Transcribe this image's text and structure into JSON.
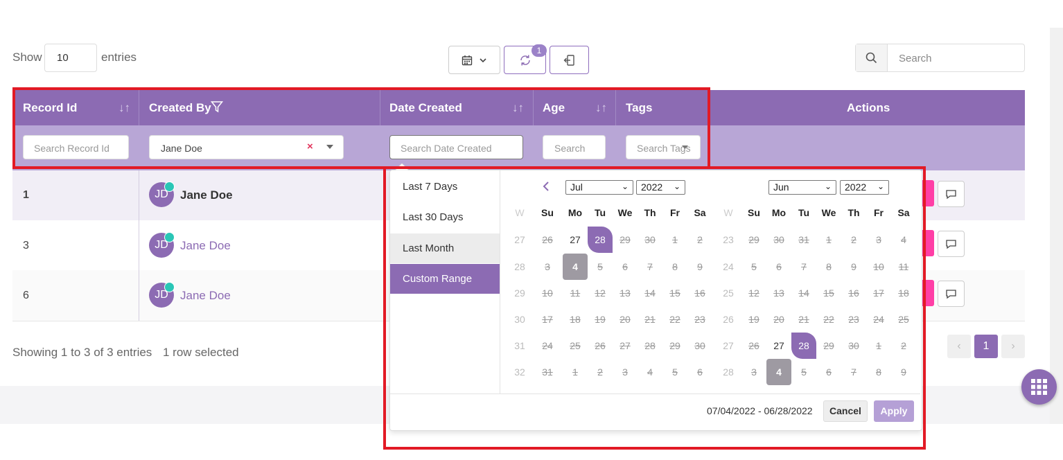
{
  "toolbar": {
    "show_label": "Show",
    "entries_value": "10",
    "entries_label": "entries",
    "sync_badge": "1",
    "search_placeholder": "Search"
  },
  "table": {
    "columns": [
      "Record Id",
      "Created By",
      "Date Created",
      "Age",
      "Tags",
      "Actions"
    ],
    "filters": {
      "record_id_placeholder": "Search Record Id",
      "created_by_value": "Jane Doe",
      "date_created_placeholder": "Search Date Created",
      "age_placeholder": "Search",
      "tags_placeholder": "Search Tags"
    },
    "rows": [
      {
        "id": "1",
        "initials": "JD",
        "name": "Jane Doe",
        "selected": true
      },
      {
        "id": "3",
        "initials": "JD",
        "name": "Jane Doe",
        "selected": false
      },
      {
        "id": "6",
        "initials": "JD",
        "name": "Jane Doe",
        "selected": false
      }
    ]
  },
  "footer": {
    "showing": "Showing 1 to 3 of 3 entries",
    "selected": "1 row selected",
    "page": "1"
  },
  "datepicker": {
    "ranges": [
      "Last 7 Days",
      "Last 30 Days",
      "Last Month",
      "Custom Range"
    ],
    "active_range": "Custom Range",
    "left": {
      "month": "Jul",
      "year": "2022"
    },
    "right": {
      "month": "Jun",
      "year": "2022"
    },
    "weekday_headers": [
      "W",
      "Su",
      "Mo",
      "Tu",
      "We",
      "Th",
      "Fr",
      "Sa"
    ],
    "left_weeks": [
      [
        "27",
        "26",
        "27",
        "28",
        "29",
        "30",
        "1",
        "2"
      ],
      [
        "28",
        "3",
        "4",
        "5",
        "6",
        "7",
        "8",
        "9"
      ],
      [
        "29",
        "10",
        "11",
        "12",
        "13",
        "14",
        "15",
        "16"
      ],
      [
        "30",
        "17",
        "18",
        "19",
        "20",
        "21",
        "22",
        "23"
      ],
      [
        "31",
        "24",
        "25",
        "26",
        "27",
        "28",
        "29",
        "30"
      ],
      [
        "32",
        "31",
        "1",
        "2",
        "3",
        "4",
        "5",
        "6"
      ]
    ],
    "right_weeks": [
      [
        "23",
        "29",
        "30",
        "31",
        "1",
        "2",
        "3",
        "4"
      ],
      [
        "24",
        "5",
        "6",
        "7",
        "8",
        "9",
        "10",
        "11"
      ],
      [
        "25",
        "12",
        "13",
        "14",
        "15",
        "16",
        "17",
        "18"
      ],
      [
        "26",
        "19",
        "20",
        "21",
        "22",
        "23",
        "24",
        "25"
      ],
      [
        "27",
        "26",
        "27",
        "28",
        "29",
        "30",
        "1",
        "2"
      ],
      [
        "28",
        "3",
        "4",
        "5",
        "6",
        "7",
        "8",
        "9"
      ]
    ],
    "range_text": "07/04/2022 - 06/28/2022",
    "cancel_label": "Cancel",
    "apply_label": "Apply"
  },
  "colors": {
    "accent": "#8c6bb3",
    "highlight": "#e21a25",
    "pink": "#ff3fa6",
    "online": "#2ac6b6"
  }
}
